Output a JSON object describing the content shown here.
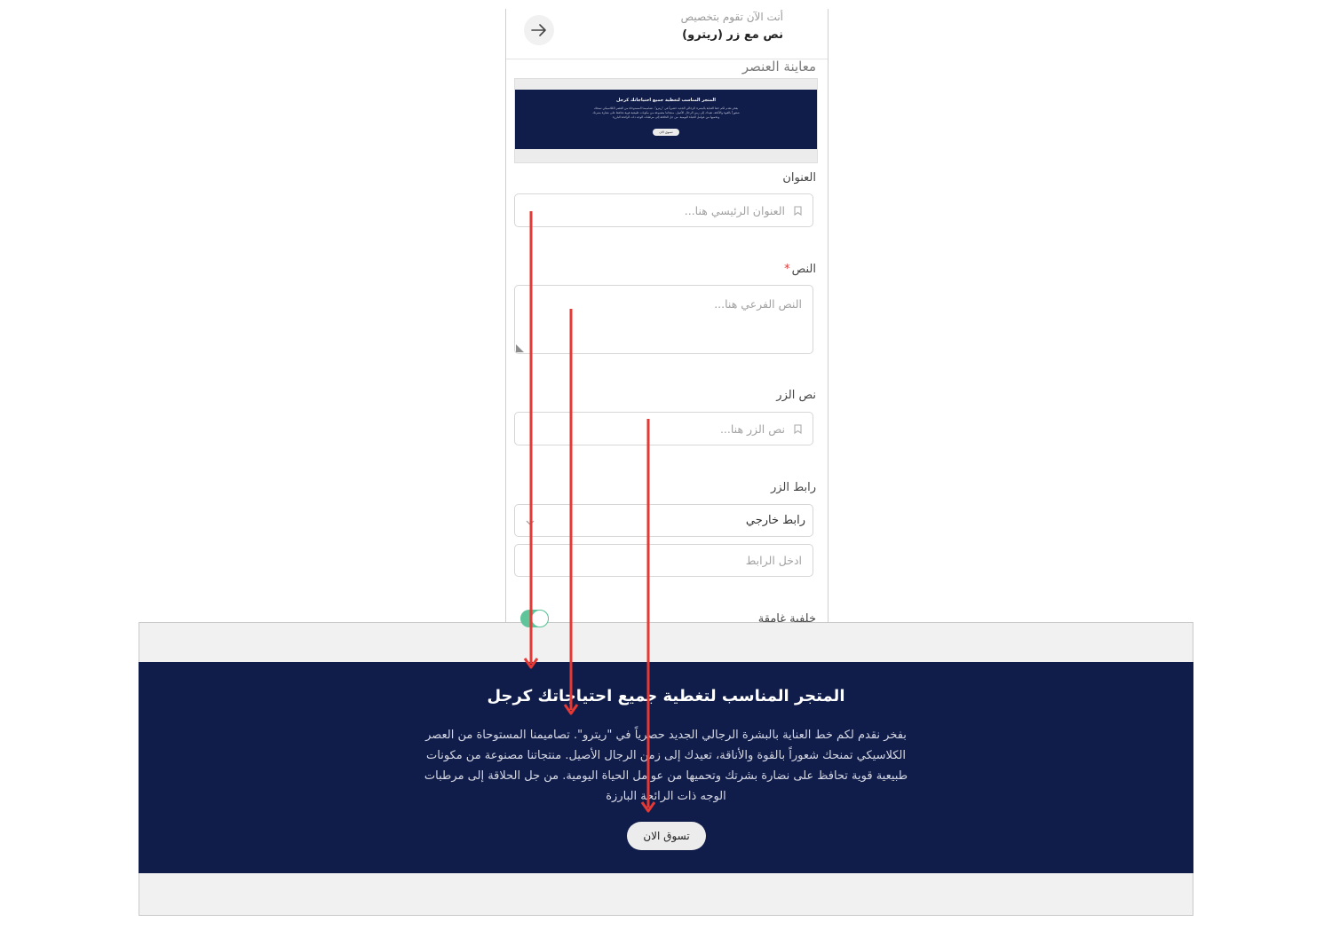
{
  "panel": {
    "header": {
      "subtitle": "أنت الآن تقوم بتخصيص",
      "title": "نص مع زر (ريترو)"
    },
    "preview_title": "معاينة العنصر",
    "fields": {
      "heading": {
        "label": "العنوان",
        "placeholder": "العنوان الرئيسي هنا..."
      },
      "text": {
        "label": "النص",
        "required_mark": "*",
        "placeholder": "النص الفرعي هنا..."
      },
      "button_text": {
        "label": "نص الزر",
        "placeholder": "نص الزر هنا..."
      },
      "button_link": {
        "label": "رابط الزر",
        "select_value": "رابط خارجي",
        "link_placeholder": "ادخل الرابط"
      },
      "dark_background": {
        "label": "خلفية غامقة",
        "enabled": true
      }
    }
  },
  "banner": {
    "title": "المتجر المناسب لتغطية جميع احتياجاتك كرجل",
    "text": "بفخر نقدم لكم خط العناية بالبشرة الرجالي الجديد حصرياً في \"ريترو\". تصاميمنا المستوحاة من العصر الكلاسيكي تمنحك شعوراً بالقوة والأناقة، تعيدك إلى زمن الرجال الأصيل. منتجاتنا مصنوعة من مكونات طبيعية قوية تحافظ على نضارة بشرتك وتحميها من عوامل الحياة اليومية. من جل الحلاقة إلى مرطبات الوجه ذات الرائحة البارزة",
    "button_label": "تسوق الان"
  },
  "colors": {
    "banner_bg": "#101c4a",
    "toggle_on": "#5ec49a",
    "arrow": "#e53935",
    "required": "#e23b3b"
  },
  "icons": {
    "back": "arrow-right-icon",
    "field": "bookmark-icon",
    "select": "chevron-down-icon"
  }
}
